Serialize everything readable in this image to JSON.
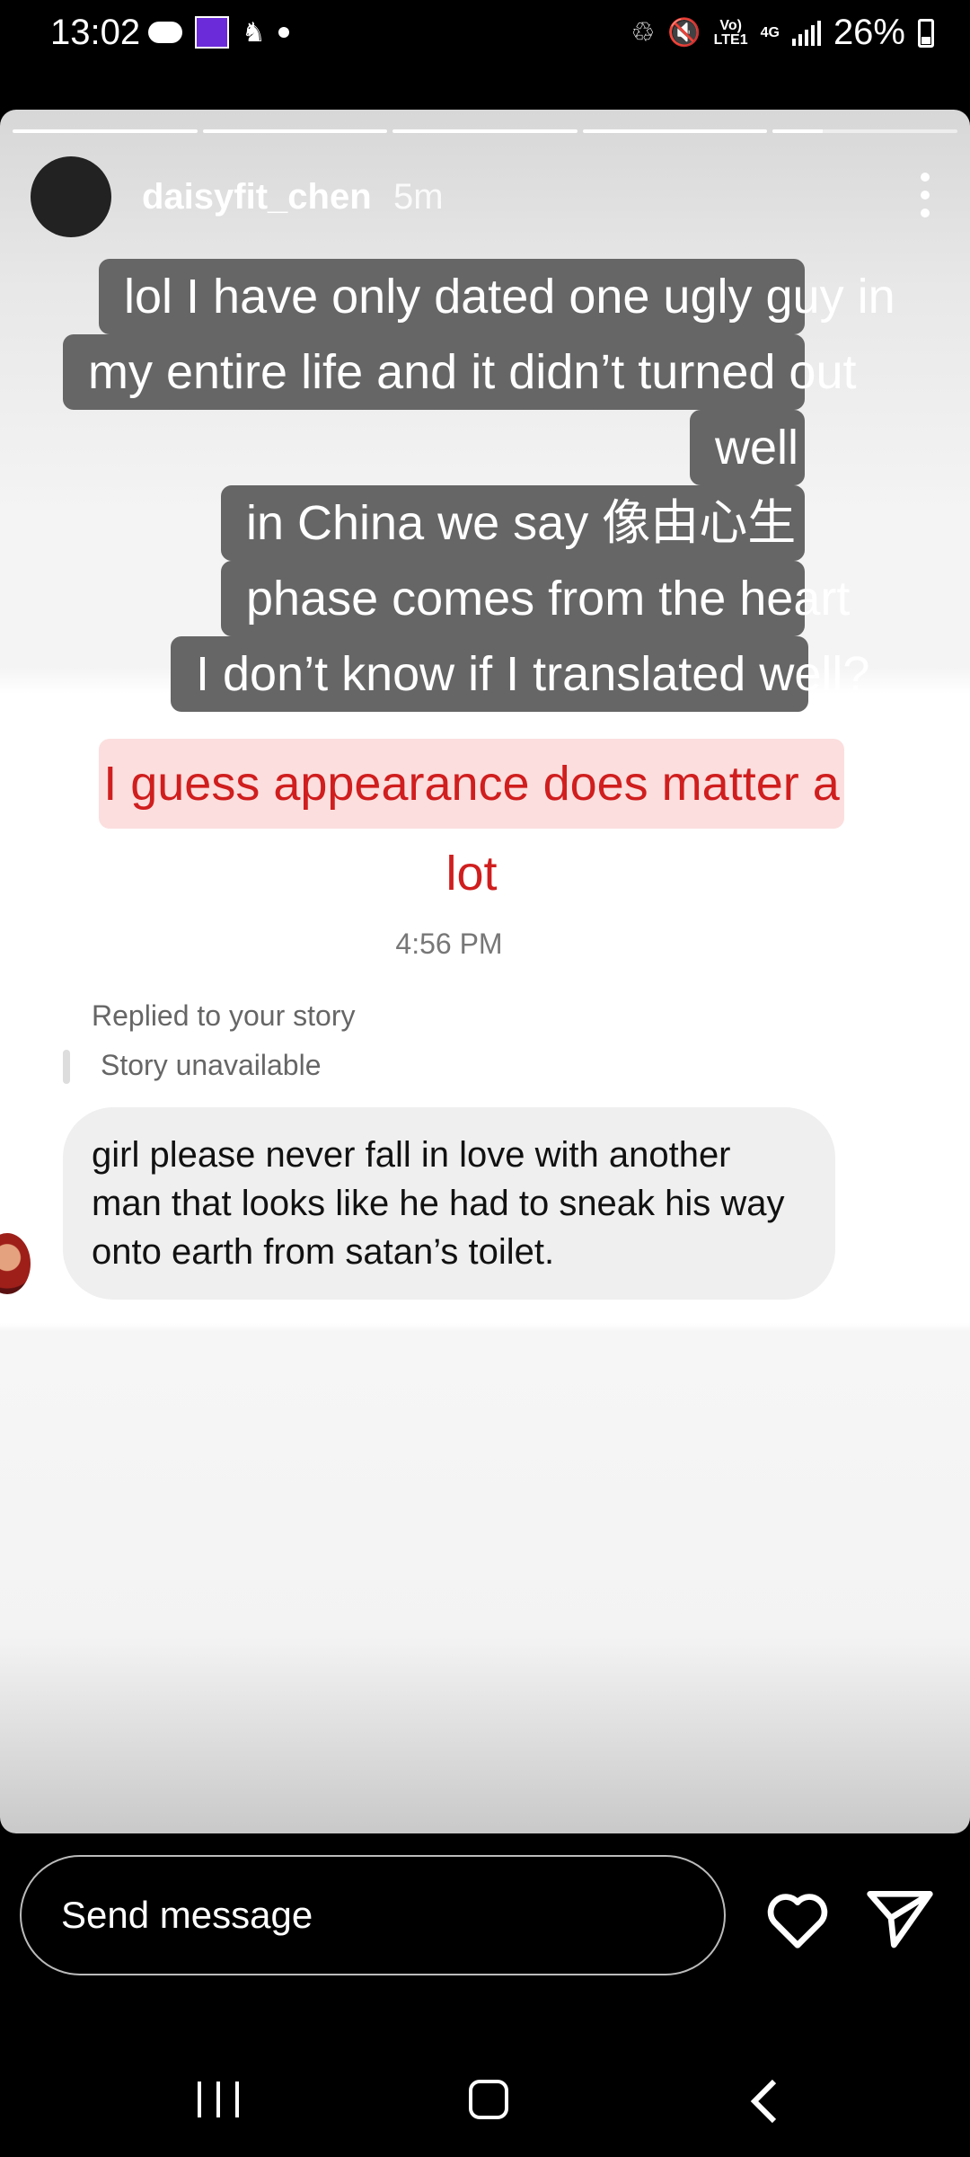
{
  "status_bar": {
    "time": "13:02",
    "network_top": "Vo)",
    "network_bottom": "LTE1",
    "network_type": "4G",
    "battery": "26%",
    "icons": [
      "cloud-icon",
      "app-icon",
      "notification-icon",
      "dot-icon",
      "recycle-icon",
      "mute-icon",
      "signal-icon",
      "battery-icon"
    ]
  },
  "story": {
    "progress_segments": [
      1,
      1,
      1,
      1,
      0.27
    ],
    "username": "daisyfit_chen",
    "time_ago": "5m",
    "caption_lines": [
      "lol I have only dated one ugly guy in",
      "my entire life and it didn’t turned out",
      "well",
      "in China we say 像由心生",
      "phase comes from the heart",
      "I don’t know if I translated well?"
    ],
    "highlight": "I guess appearance does matter a lot",
    "chat_time": "4:56 PM",
    "replied_label": "Replied to your story",
    "story_unavailable": "Story unavailable",
    "message": "girl please never fall in love with another man that looks like he had to sneak his way onto earth from satan’s toilet."
  },
  "composer": {
    "placeholder": "Send message"
  },
  "colors": {
    "caption_bg": "#666666",
    "highlight_bg": "#fcdede",
    "highlight_text": "#d01e1e",
    "bubble_bg": "#efefef"
  }
}
